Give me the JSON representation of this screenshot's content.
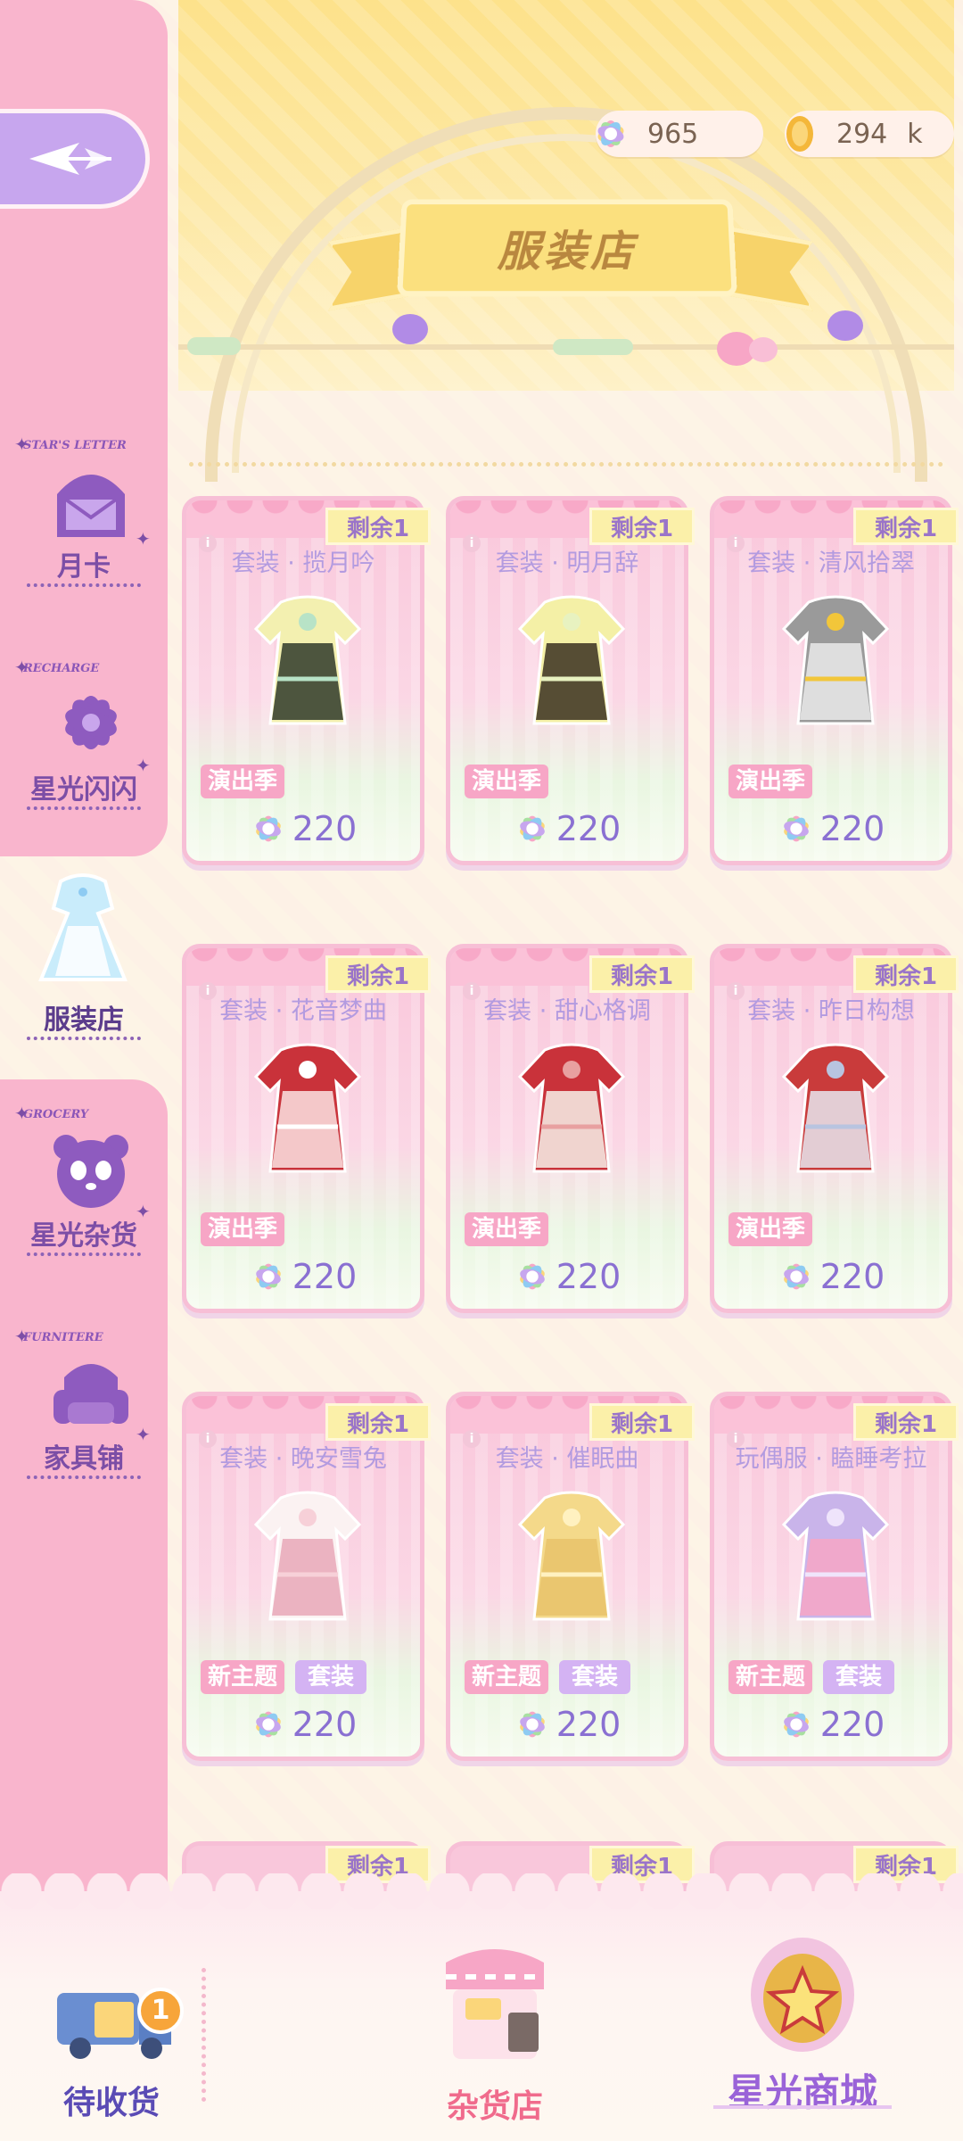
{
  "currency": {
    "stars": "965",
    "coins": "294",
    "coins_unit": "k"
  },
  "banner": {
    "title": "服装店"
  },
  "sidebar": {
    "items": [
      {
        "tag": "STAR'S LETTER",
        "label": "月卡",
        "icon": "letter-icon"
      },
      {
        "tag": "RECHARGE",
        "label": "星光闪闪",
        "icon": "flower-icon"
      },
      {
        "tag": "",
        "label": "服装店",
        "icon": "dress-icon",
        "active": true
      },
      {
        "tag": "GROCERY",
        "label": "星光杂货",
        "icon": "panda-icon"
      },
      {
        "tag": "FURNITERE",
        "label": "家具铺",
        "icon": "armchair-icon"
      }
    ]
  },
  "shop": {
    "items": [
      {
        "remain": "剩余1",
        "name": "套装 · 揽月吟",
        "tags": [
          "演出季"
        ],
        "price": "220"
      },
      {
        "remain": "剩余1",
        "name": "套装 · 明月辞",
        "tags": [
          "演出季"
        ],
        "price": "220"
      },
      {
        "remain": "剩余1",
        "name": "套装 · 清风拾翠",
        "tags": [
          "演出季"
        ],
        "price": "220"
      },
      {
        "remain": "剩余1",
        "name": "套装 · 花音梦曲",
        "tags": [
          "演出季"
        ],
        "price": "220"
      },
      {
        "remain": "剩余1",
        "name": "套装 · 甜心格调",
        "tags": [
          "演出季"
        ],
        "price": "220"
      },
      {
        "remain": "剩余1",
        "name": "套装 · 昨日构想",
        "tags": [
          "演出季"
        ],
        "price": "220"
      },
      {
        "remain": "剩余1",
        "name": "套装 · 晚安雪兔",
        "tags": [
          "新主题",
          "套装"
        ],
        "price": "220"
      },
      {
        "remain": "剩余1",
        "name": "套装 · 催眠曲",
        "tags": [
          "新主题",
          "套装"
        ],
        "price": "220"
      },
      {
        "remain": "剩余1",
        "name": "玩偶服 · 瞌睡考拉",
        "tags": [
          "新主题",
          "套装"
        ],
        "price": "220"
      }
    ],
    "next_row": [
      {
        "remain": "剩余1"
      },
      {
        "remain": "剩余1"
      },
      {
        "remain": "剩余1"
      }
    ]
  },
  "bottom_nav": {
    "delivery": {
      "label": "待收货",
      "badge": "1"
    },
    "grocery": {
      "label": "杂货店"
    },
    "mall": {
      "label": "星光商城"
    }
  },
  "colors": {
    "accent_purple": "#8a70d2",
    "card_pink": "#f9c7db",
    "sidebar_pink": "#f9b5cd",
    "banner_yellow": "#fde28b"
  }
}
